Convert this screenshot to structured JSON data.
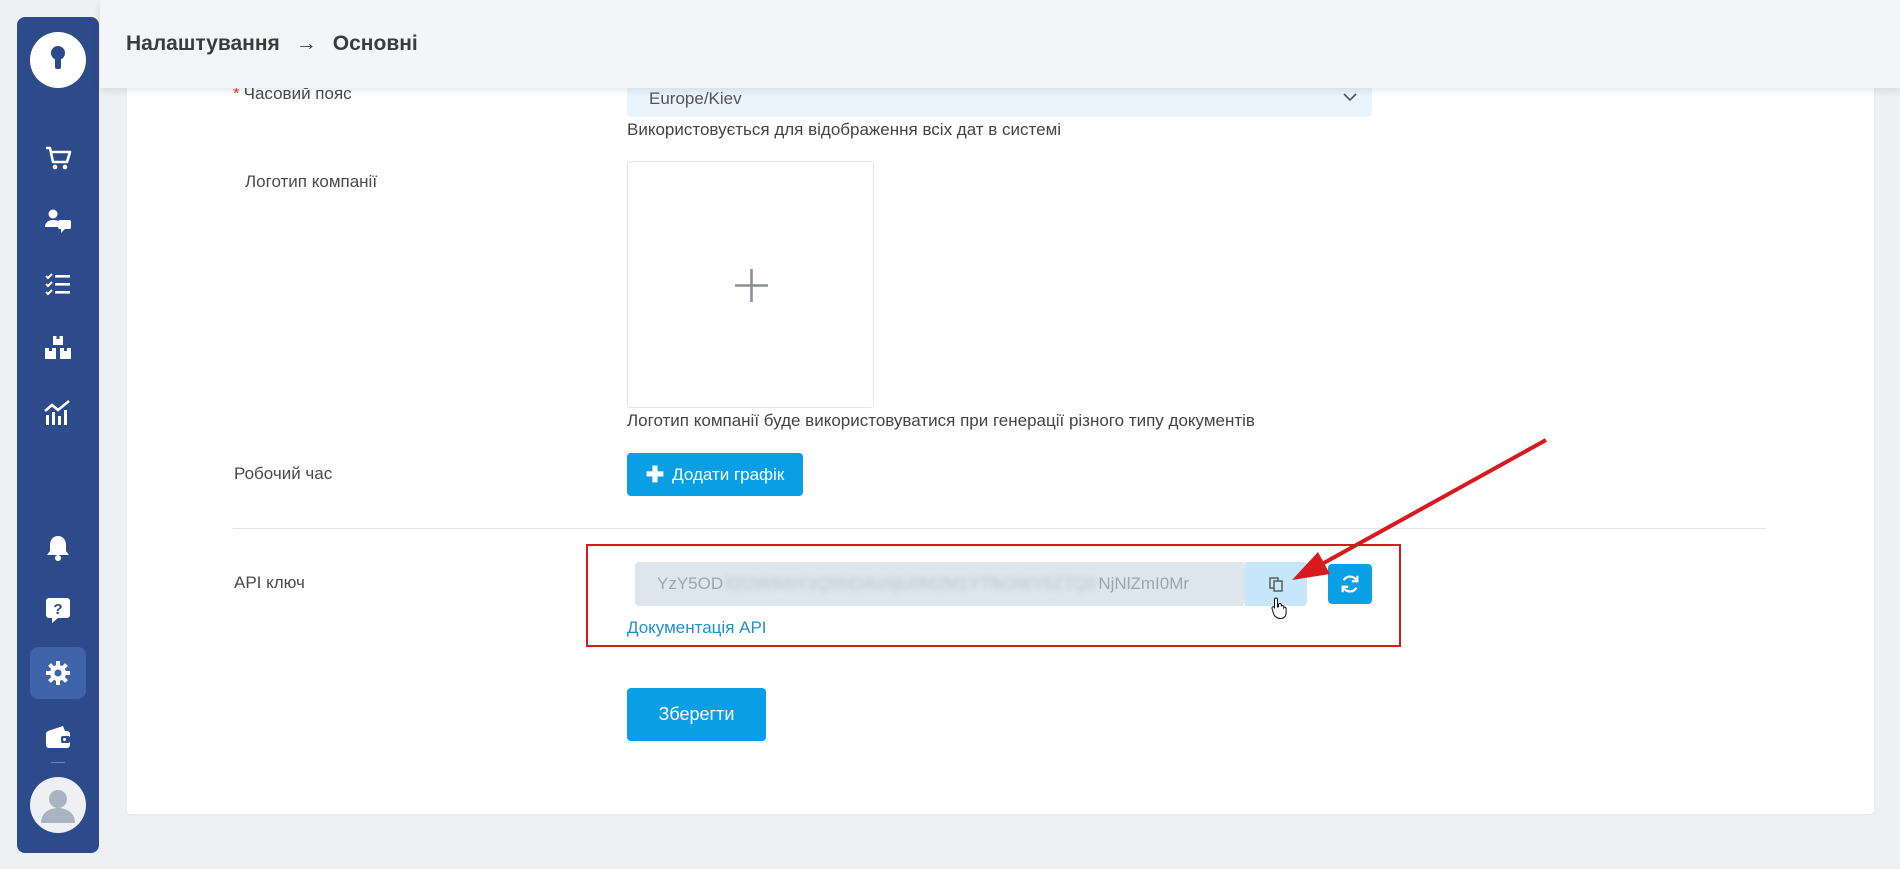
{
  "breadcrumb": {
    "parent": "Налаштування",
    "separator": "→",
    "current": "Основні"
  },
  "sidebar": {
    "items": [
      {
        "icon": "cart-icon",
        "active": false
      },
      {
        "icon": "user-chat-icon",
        "active": false
      },
      {
        "icon": "checklist-icon",
        "active": false
      },
      {
        "icon": "boxes-icon",
        "active": false
      },
      {
        "icon": "analytics-icon",
        "active": false
      },
      {
        "icon": "bell-icon",
        "active": false
      },
      {
        "icon": "help-icon",
        "active": false
      },
      {
        "icon": "gear-icon",
        "active": true
      },
      {
        "icon": "wallet-icon",
        "active": false
      }
    ]
  },
  "form": {
    "timezone": {
      "label": "Часовий пояс",
      "required_mark": "*",
      "value": "Europe/Kiev",
      "help": "Використовується для відображення всіх дат в системі"
    },
    "logo": {
      "label": "Логотип компанії",
      "help": "Логотип компанії буде використовуватися при генерації різного типу документів"
    },
    "work_hours": {
      "label": "Робочий час",
      "add_button": "Додати графік",
      "add_button_plus": "✚"
    },
    "api_key": {
      "label": "API ключ",
      "value_start": "YzY5OD",
      "value_hidden": "ll2OWIkNYzQ5NDAxNjU0M2M1YTlkOWY5ZTQ0",
      "value_end": "NjNlZmI0Mr",
      "docs_link": "Документація API"
    },
    "save_button": "Зберегти"
  },
  "colors": {
    "sidebar": "#2d4a8a",
    "sidebar_active": "#3f63a8",
    "primary": "#0a9ee5",
    "link": "#1f8fd1",
    "annotation": "#d9191e"
  }
}
